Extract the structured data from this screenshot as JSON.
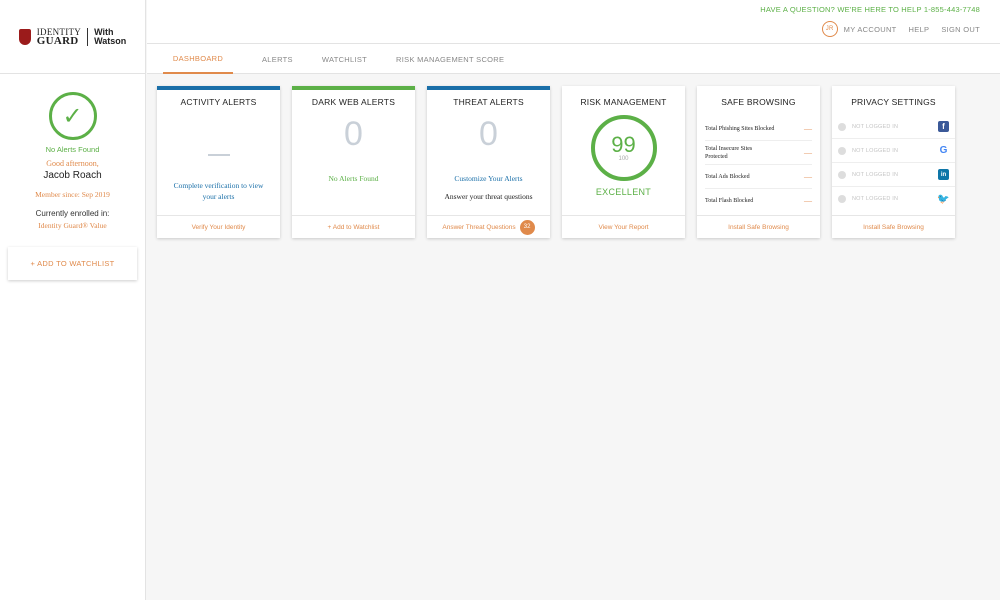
{
  "header": {
    "help_line": "HAVE A QUESTION? WE'RE HERE TO HELP 1-855-443-7748",
    "initials": "JR",
    "my_account": "MY ACCOUNT",
    "help": "HELP",
    "sign_out": "SIGN OUT",
    "tabs": [
      {
        "label": "DASHBOARD"
      },
      {
        "label": "ALERTS"
      },
      {
        "label": "WATCHLIST"
      },
      {
        "label": "RISK MANAGEMENT SCORE"
      }
    ]
  },
  "logo": {
    "line1": "IDENTITY",
    "line2": "GUARD",
    "with": "With",
    "watson": "Watson"
  },
  "sidebar": {
    "status": "No Alerts Found",
    "greeting": "Good afternoon,",
    "name": "Jacob Roach",
    "member_since": "Member since: Sep 2019",
    "enrolled_label": "Currently enrolled in:",
    "plan": "Identity Guard® Value",
    "add_watchlist": "+ ADD TO WATCHLIST"
  },
  "cards": {
    "activity": {
      "title": "ACTIVITY ALERTS",
      "message": "Complete verification to view your alerts",
      "footer": "Verify Your Identity",
      "color": "#1a6fa8"
    },
    "darkweb": {
      "title": "DARK WEB ALERTS",
      "count": "0",
      "message": "No Alerts Found",
      "footer": "+ Add to Watchlist",
      "color": "#5cb047"
    },
    "threat": {
      "title": "THREAT ALERTS",
      "count": "0",
      "message": "Customize Your Alerts",
      "sub": "Answer your threat questions",
      "footer": "Answer Threat Questions",
      "badge": "32",
      "color": "#1a6fa8"
    },
    "risk": {
      "title": "RISK MANAGEMENT",
      "score": "99",
      "max": "100",
      "rating": "EXCELLENT",
      "footer": "View Your Report"
    },
    "safe": {
      "title": "SAFE BROWSING",
      "rows": [
        {
          "label": "Total Phishing Sites Blocked",
          "value": "—"
        },
        {
          "label": "Total Insecure Sites Protected",
          "value": "—"
        },
        {
          "label": "Total Ads Blocked",
          "value": "—"
        },
        {
          "label": "Total Flash Blocked",
          "value": "—"
        }
      ],
      "footer": "Install Safe Browsing"
    },
    "privacy": {
      "title": "PRIVACY SETTINGS",
      "rows": [
        {
          "status": "NOT LOGGED IN",
          "icon": "facebook-icon"
        },
        {
          "status": "NOT LOGGED IN",
          "icon": "google-icon"
        },
        {
          "status": "NOT LOGGED IN",
          "icon": "linkedin-icon"
        },
        {
          "status": "NOT LOGGED IN",
          "icon": "twitter-icon"
        }
      ],
      "footer": "Install Safe Browsing"
    }
  }
}
